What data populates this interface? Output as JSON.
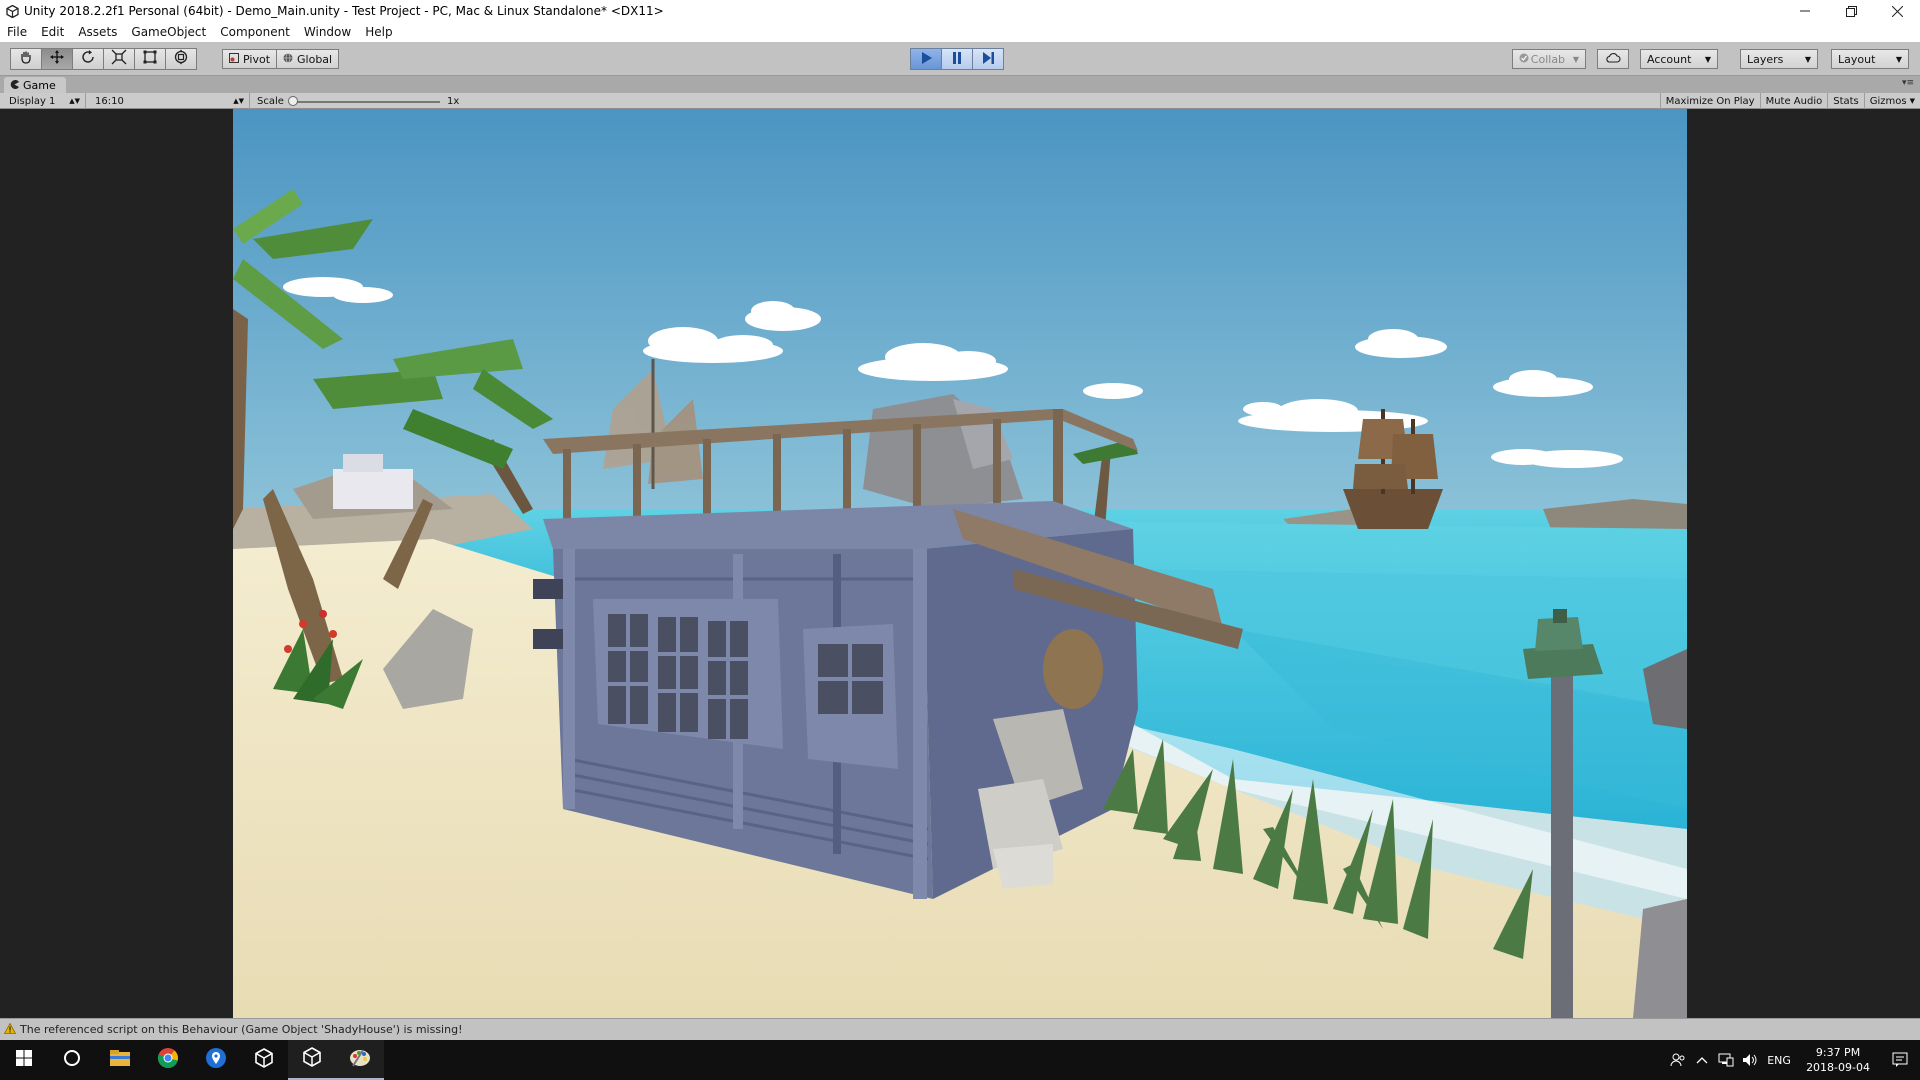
{
  "window": {
    "title": "Unity 2018.2.2f1 Personal (64bit) - Demo_Main.unity - Test Project - PC, Mac & Linux Standalone* <DX11>"
  },
  "menu": [
    "File",
    "Edit",
    "Assets",
    "GameObject",
    "Component",
    "Window",
    "Help"
  ],
  "toolbar": {
    "tools": [
      "hand-icon",
      "move-icon",
      "rotate-icon",
      "scale-icon",
      "rect-icon",
      "transform-icon"
    ],
    "pivot_label": "Pivot",
    "global_label": "Global",
    "collab_label": "Collab",
    "account_label": "Account",
    "layers_label": "Layers",
    "layout_label": "Layout"
  },
  "tab": {
    "label": "Game"
  },
  "gamebar": {
    "display": "Display 1",
    "aspect": "16:10",
    "scale_label": "Scale",
    "scale_value": "1x",
    "maximize": "Maximize On Play",
    "mute": "Mute Audio",
    "stats": "Stats",
    "gizmos": "Gizmos"
  },
  "status": {
    "message": "The referenced script on this Behaviour (Game Object 'ShadyHouse') is missing!"
  },
  "taskbar": {
    "lang": "ENG",
    "time": "9:37 PM",
    "date": "2018-09-04"
  },
  "colors": {
    "play_active": "#6a95d6",
    "sky_top": "#4d97c4",
    "sea": "#46c6dd",
    "sand": "#efe6c6",
    "house": "#6f7a9e"
  }
}
